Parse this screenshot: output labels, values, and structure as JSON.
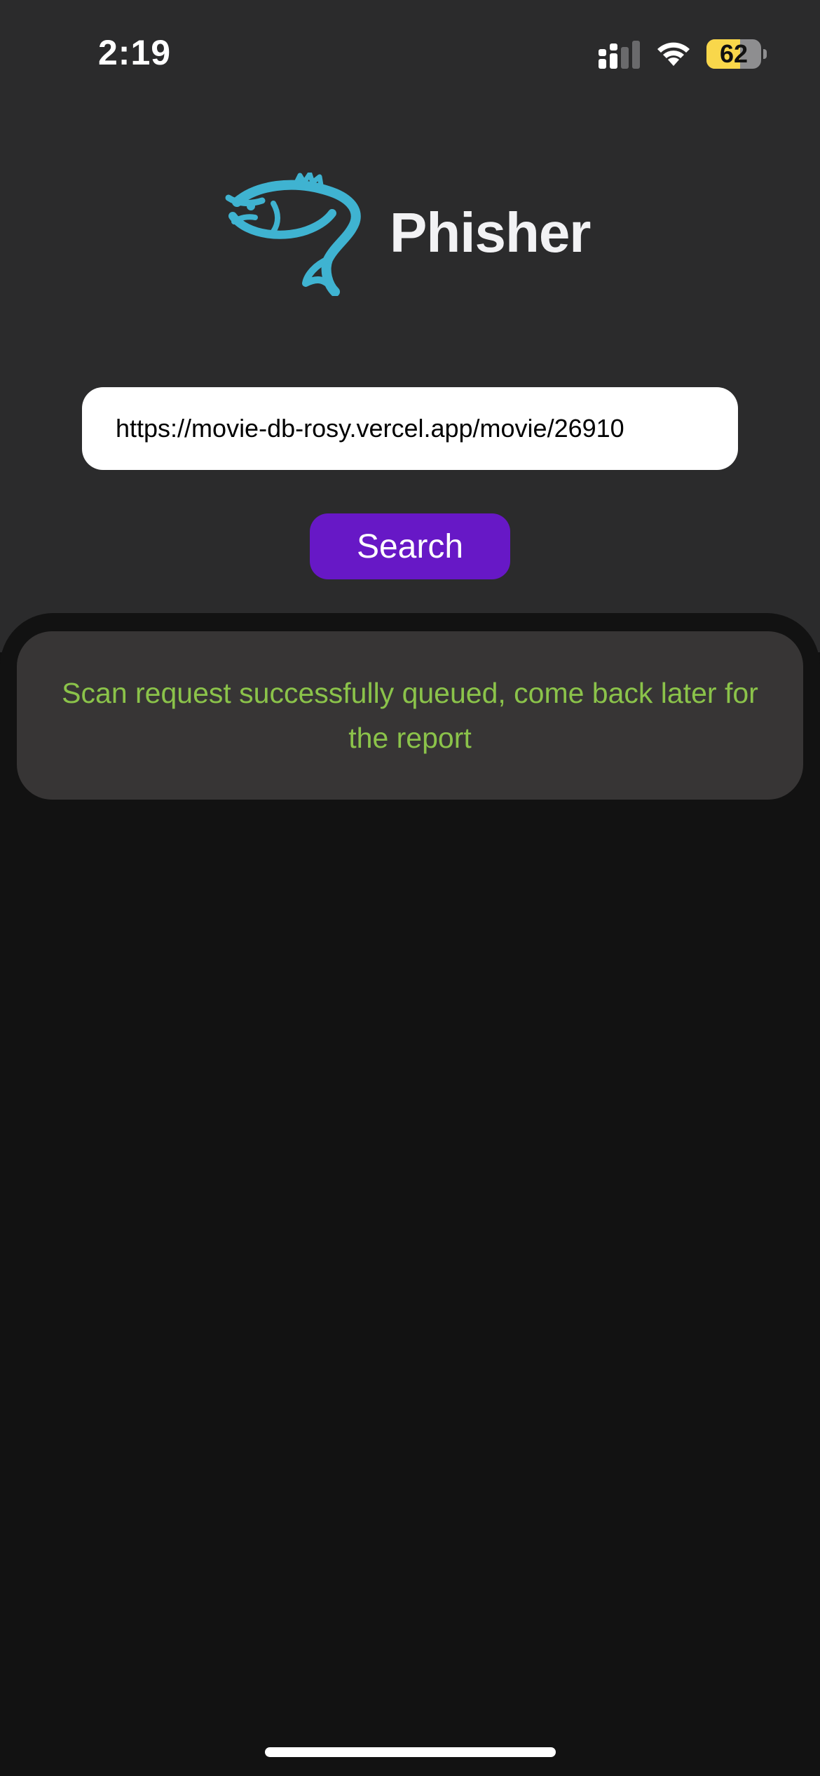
{
  "status_bar": {
    "time": "2:19",
    "battery_level": "62",
    "battery_fraction": 0.62
  },
  "brand": {
    "title": "Phisher",
    "logo_icon": "fish-icon",
    "logo_color": "#3fb3d1"
  },
  "search": {
    "url_value": "https://movie-db-rosy.vercel.app/movie/26910",
    "button_label": "Search",
    "button_color": "#6718c6"
  },
  "result": {
    "message": "Scan request successfully queued, come back later for the report",
    "message_color": "#8bc34a"
  }
}
